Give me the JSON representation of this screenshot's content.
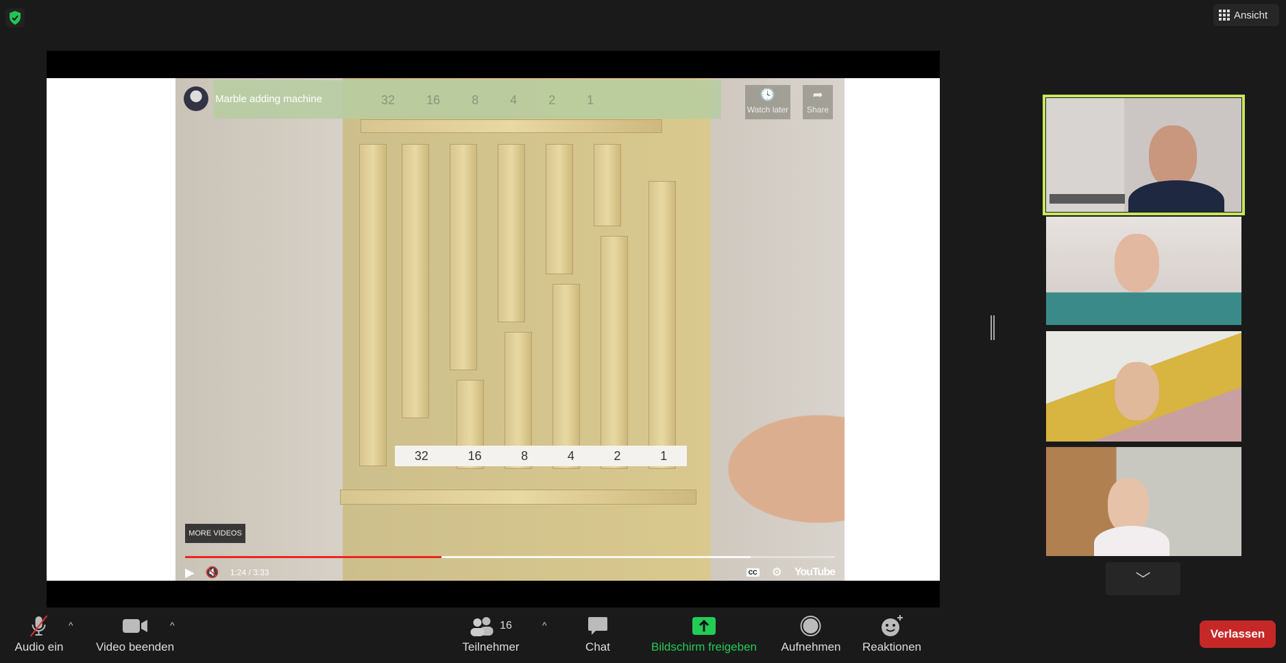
{
  "top": {
    "shield_icon": "shield-check-icon",
    "view_label": "Ansicht"
  },
  "video": {
    "title": "Marble adding machine",
    "top_numbers": [
      "32",
      "16",
      "8",
      "4",
      "2",
      "1"
    ],
    "bottom_numbers": [
      "32",
      "16",
      "8",
      "4",
      "2",
      "1"
    ],
    "watch_later": "Watch later",
    "share": "Share",
    "more_videos": "MORE VIDEOS",
    "time": "1:24 / 3:33",
    "progress_percent": 39.4,
    "buffered_percent": 87,
    "logo": "YouTube",
    "accent": "#ee2222"
  },
  "gallery": {
    "active_border": "#c8e85a"
  },
  "toolbar": {
    "audio": "Audio ein",
    "video": "Video beenden",
    "participants": "Teilnehmer",
    "participant_count": "16",
    "chat": "Chat",
    "share": "Bildschirm freigeben",
    "record": "Aufnehmen",
    "reactions": "Reaktionen",
    "leave": "Verlassen",
    "share_color": "#22cc55",
    "leave_color": "#c62828"
  }
}
